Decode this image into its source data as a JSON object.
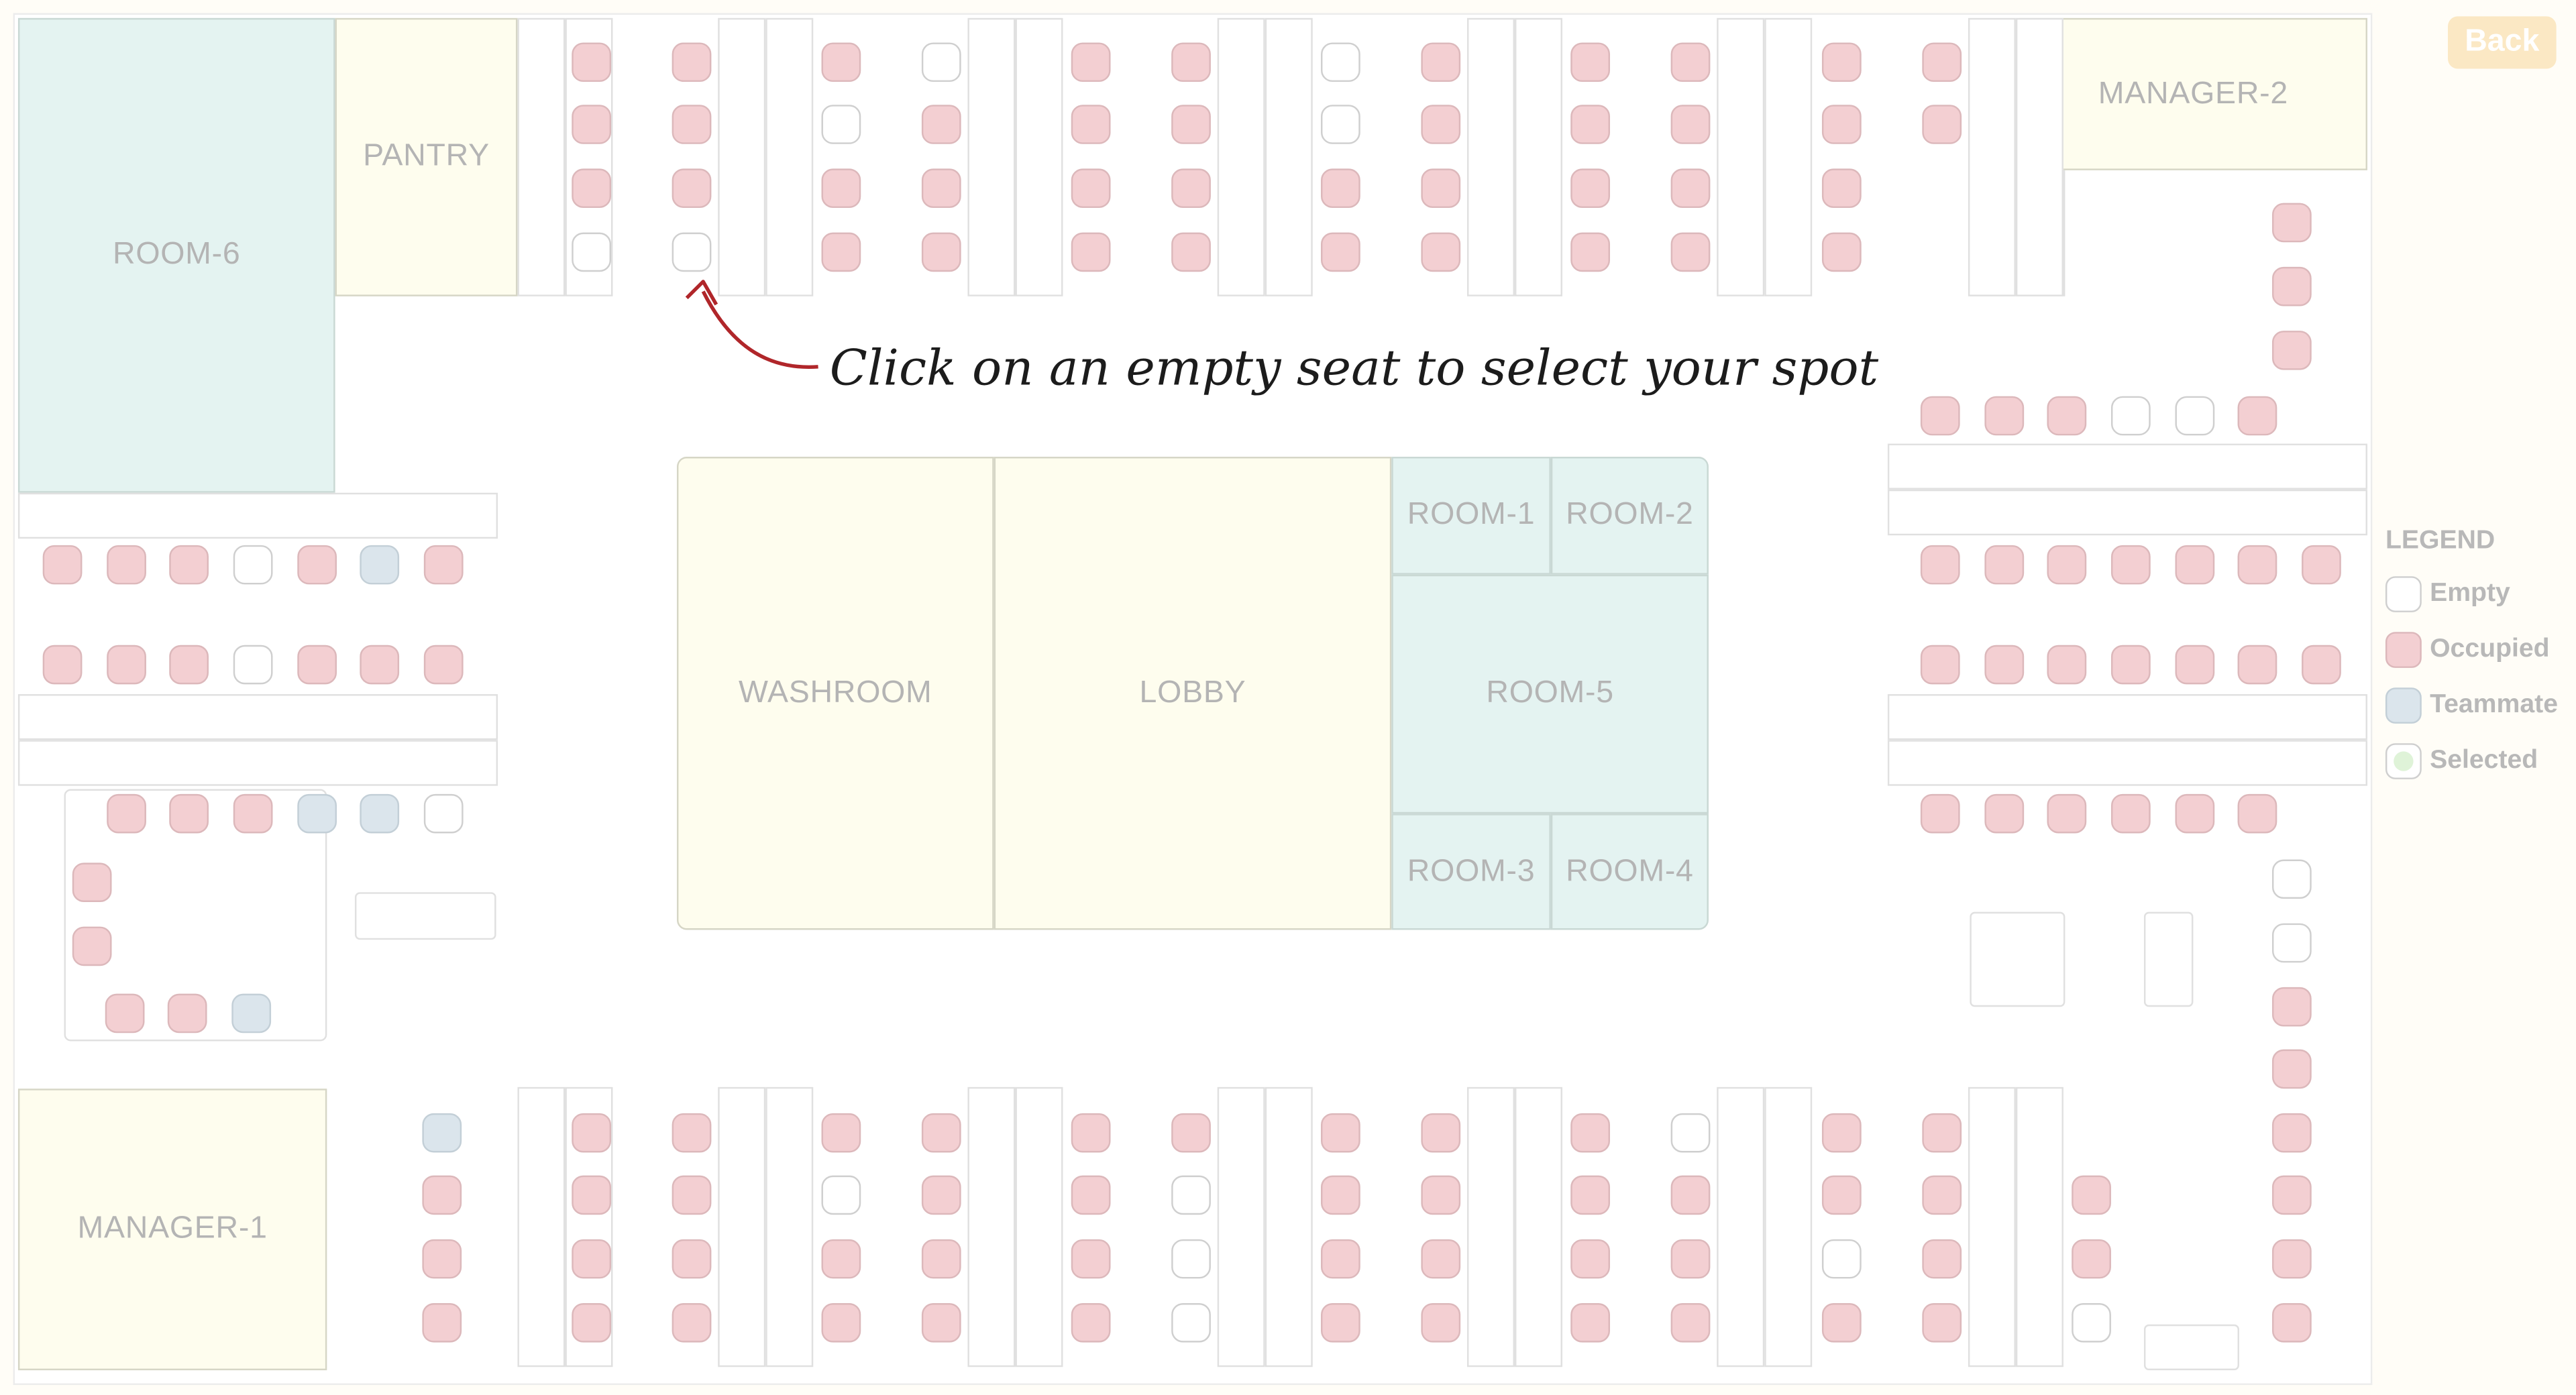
{
  "header": {
    "back_label": "Back"
  },
  "hint": {
    "text": "Click on an empty seat to select your spot"
  },
  "rooms": {
    "room6": "ROOM-6",
    "pantry": "PANTRY",
    "manager2": "MANAGER-2",
    "washroom": "WASHROOM",
    "lobby": "LOBBY",
    "room1": "ROOM-1",
    "room2": "ROOM-2",
    "room5": "ROOM-5",
    "room3": "ROOM-3",
    "room4": "ROOM-4",
    "manager1": "MANAGER-1"
  },
  "legend": {
    "title": "LEGEND",
    "empty": "Empty",
    "occupied": "Occupied",
    "teammate": "Teammate",
    "selected": "Selected"
  },
  "colors": {
    "occupied": "#f3cfd2",
    "empty": "#ffffff",
    "teammate": "#dbe5ec",
    "selected": "#dff3d8",
    "room_teal": "#e4f3f1",
    "room_cream": "#fefdee",
    "back_button": "#fbe8c4"
  },
  "seat_states": {
    "top_cluster": [
      "OOOE",
      "OOOE",
      "OEOO",
      "EOOO",
      "OOOO",
      "OOOO",
      "EEOO",
      "OOOO",
      "OOOO",
      "OOOO",
      "OOOO",
      "OO"
    ],
    "upper_right_column": [
      "O",
      "O",
      "O"
    ],
    "upper_right_row": [
      "O",
      "O",
      "O",
      "E",
      "E",
      "O"
    ],
    "left_row_1": [
      "O",
      "O",
      "O",
      "E",
      "O",
      "T",
      "O"
    ],
    "left_row_2": [
      "O",
      "O",
      "O",
      "E",
      "O",
      "O",
      "O"
    ],
    "left_block_top": [
      "O",
      "O",
      "O",
      "T",
      "T",
      "E"
    ],
    "left_block_side": [
      "O",
      "O"
    ],
    "left_block_bottom": [
      "O",
      "O",
      "T"
    ],
    "right_row_1": [
      "O",
      "O",
      "O",
      "O",
      "O",
      "O",
      "O"
    ],
    "right_row_2": [
      "O",
      "O",
      "O",
      "O",
      "O",
      "O",
      "O"
    ],
    "right_row_3": [
      "O",
      "O",
      "O",
      "O",
      "O",
      "O"
    ],
    "right_column": [
      "E",
      "E",
      "O",
      "O",
      "O",
      "O",
      "O",
      "O"
    ],
    "bottom_left_column": [
      "T",
      "O",
      "O",
      "O"
    ],
    "bottom_cluster": [
      "OOOO",
      "OOOO",
      "OEOO",
      "OOOO",
      "OOOO",
      "OEEE",
      "OOOO",
      "OOOO",
      "OOOO",
      "EOOO",
      "OOEO",
      "OOOO"
    ],
    "bottom_extra_column": [
      "O",
      "O",
      "E"
    ]
  }
}
